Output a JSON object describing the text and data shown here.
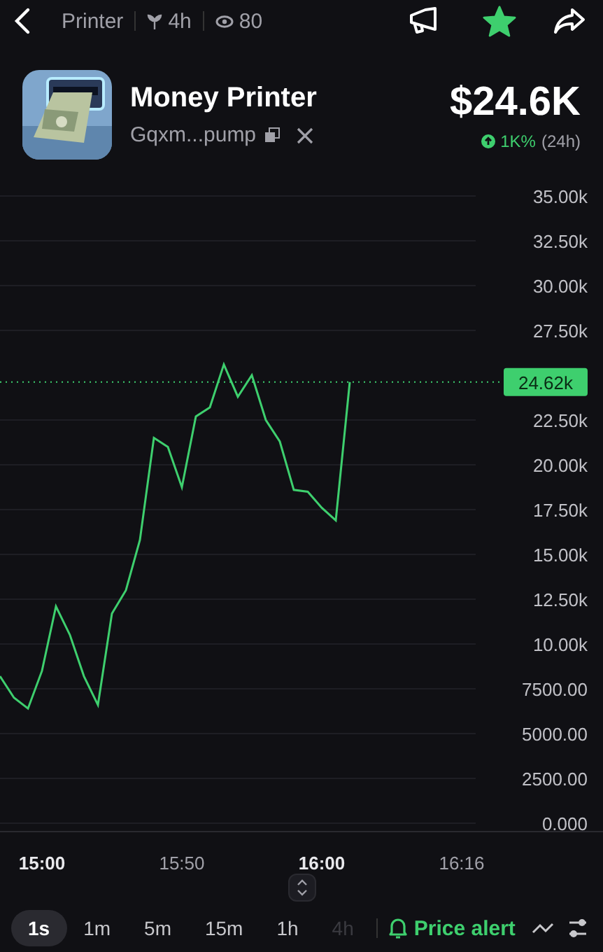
{
  "top_bar": {
    "title": "Printer",
    "age": "4h",
    "views": "80",
    "starred": true
  },
  "token": {
    "name": "Money Printer",
    "address": "Gqxm...pump",
    "price": "$24.6K",
    "change": "1K%",
    "period": "(24h)"
  },
  "chart": {
    "chart_data": {
      "type": "line",
      "categories": [
        null,
        null,
        null,
        "15:00",
        null,
        null,
        null,
        null,
        null,
        null,
        null,
        null,
        null,
        "15:50",
        null,
        null,
        null,
        null,
        null,
        null,
        null,
        null,
        null,
        "16:00",
        null,
        null,
        null,
        null,
        null,
        null,
        null,
        null,
        null,
        "16:16",
        null
      ],
      "series": [
        {
          "color": "#3ecf6e",
          "values": [
            8200,
            7000,
            6400,
            8500,
            12100,
            10500,
            8200,
            6600,
            11700,
            13000,
            15800,
            21500,
            21000,
            18750,
            22700,
            23200,
            25600,
            23800,
            25000,
            22500,
            21300,
            18600,
            18500,
            17600,
            16900,
            24620,
            null,
            null,
            null,
            null,
            null,
            null,
            null,
            null,
            null
          ]
        }
      ],
      "ylim": [
        0,
        35000
      ],
      "grid": true,
      "ref_lines": [
        {
          "axis": "y",
          "value": 24620,
          "label": "24.62k"
        }
      ],
      "yticks": [
        {
          "value": 35000,
          "label": "35.00k"
        },
        {
          "value": 32500,
          "label": "32.50k"
        },
        {
          "value": 30000,
          "label": "30.00k"
        },
        {
          "value": 27500,
          "label": "27.50k"
        },
        {
          "value": 22500,
          "label": "22.50k"
        },
        {
          "value": 20000,
          "label": "20.00k"
        },
        {
          "value": 17500,
          "label": "17.50k"
        },
        {
          "value": 15000,
          "label": "15.00k"
        },
        {
          "value": 12500,
          "label": "12.50k"
        },
        {
          "value": 10000,
          "label": "10.00k"
        },
        {
          "value": 7500,
          "label": "7500.00"
        },
        {
          "value": 5000,
          "label": "5000.00"
        },
        {
          "value": 2500,
          "label": "2500.00"
        },
        {
          "value": 0,
          "label": "0.000"
        }
      ]
    }
  },
  "intervals": [
    {
      "label": "1s",
      "selected": true,
      "dimmed": false
    },
    {
      "label": "1m",
      "selected": false,
      "dimmed": false
    },
    {
      "label": "5m",
      "selected": false,
      "dimmed": false
    },
    {
      "label": "15m",
      "selected": false,
      "dimmed": false
    },
    {
      "label": "1h",
      "selected": false,
      "dimmed": false
    },
    {
      "label": "4h",
      "selected": false,
      "dimmed": true
    }
  ],
  "price_alert": "Price alert"
}
